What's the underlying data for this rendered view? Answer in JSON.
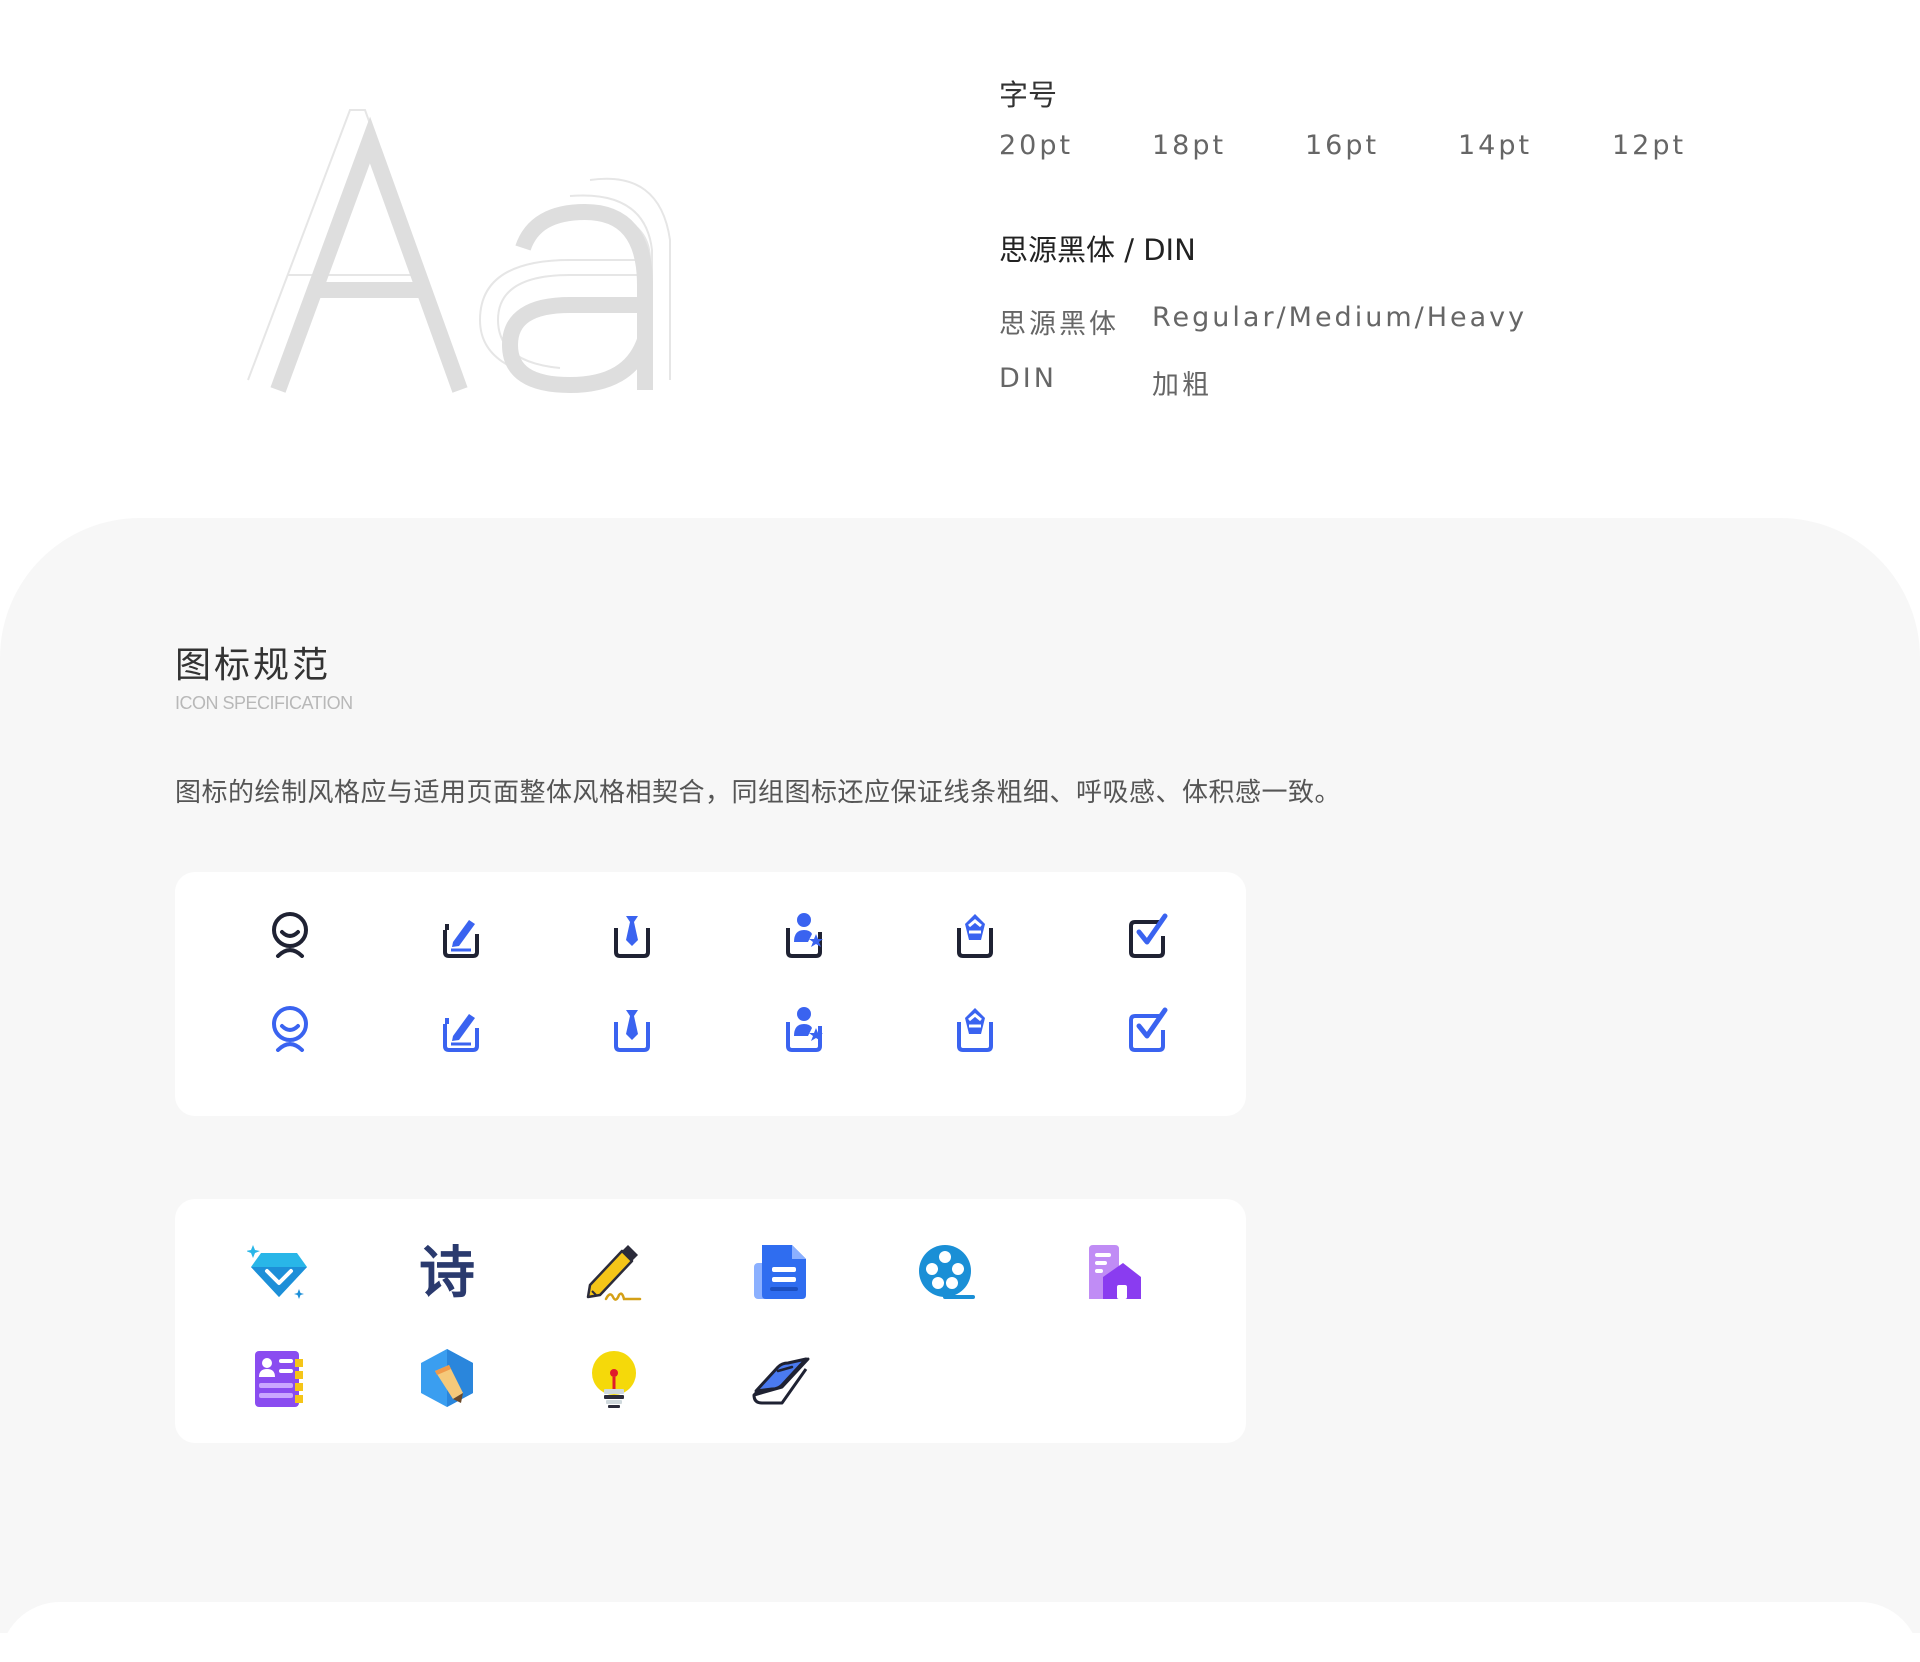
{
  "typography": {
    "sample_glyphs": "Aa",
    "size_heading": "字号",
    "sizes": [
      "20pt",
      "18pt",
      "16pt",
      "14pt",
      "12pt"
    ],
    "font_heading": "思源黑体 / DIN",
    "fonts": [
      {
        "name": "思源黑体",
        "weights": "Regular/Medium/Heavy"
      },
      {
        "name": "DIN",
        "weights": "加粗"
      }
    ]
  },
  "icon_spec": {
    "title": "图标规范",
    "subtitle": "ICON SPECIFICATION",
    "description": "图标的绘制风格应与适用页面整体风格相契合，同组图标还应保证线条粗细、呼吸感、体积感一致。",
    "line_icons": [
      "user-face-icon",
      "edit-note-icon",
      "tie-note-icon",
      "user-star-note-icon",
      "badge-note-icon",
      "check-note-icon"
    ],
    "line_icon_colors": {
      "dark": "#1f2233",
      "blue": "#3a63f0"
    },
    "color_icons": [
      {
        "name": "diamond-icon",
        "label": ""
      },
      {
        "name": "poem-icon",
        "label": "诗"
      },
      {
        "name": "pencil-sign-icon",
        "label": ""
      },
      {
        "name": "document-icon",
        "label": ""
      },
      {
        "name": "film-reel-icon",
        "label": ""
      },
      {
        "name": "building-icon",
        "label": ""
      },
      {
        "name": "contact-book-icon",
        "label": ""
      },
      {
        "name": "hexagon-pencil-icon",
        "label": ""
      },
      {
        "name": "lightbulb-icon",
        "label": ""
      },
      {
        "name": "book-icon",
        "label": ""
      }
    ]
  }
}
